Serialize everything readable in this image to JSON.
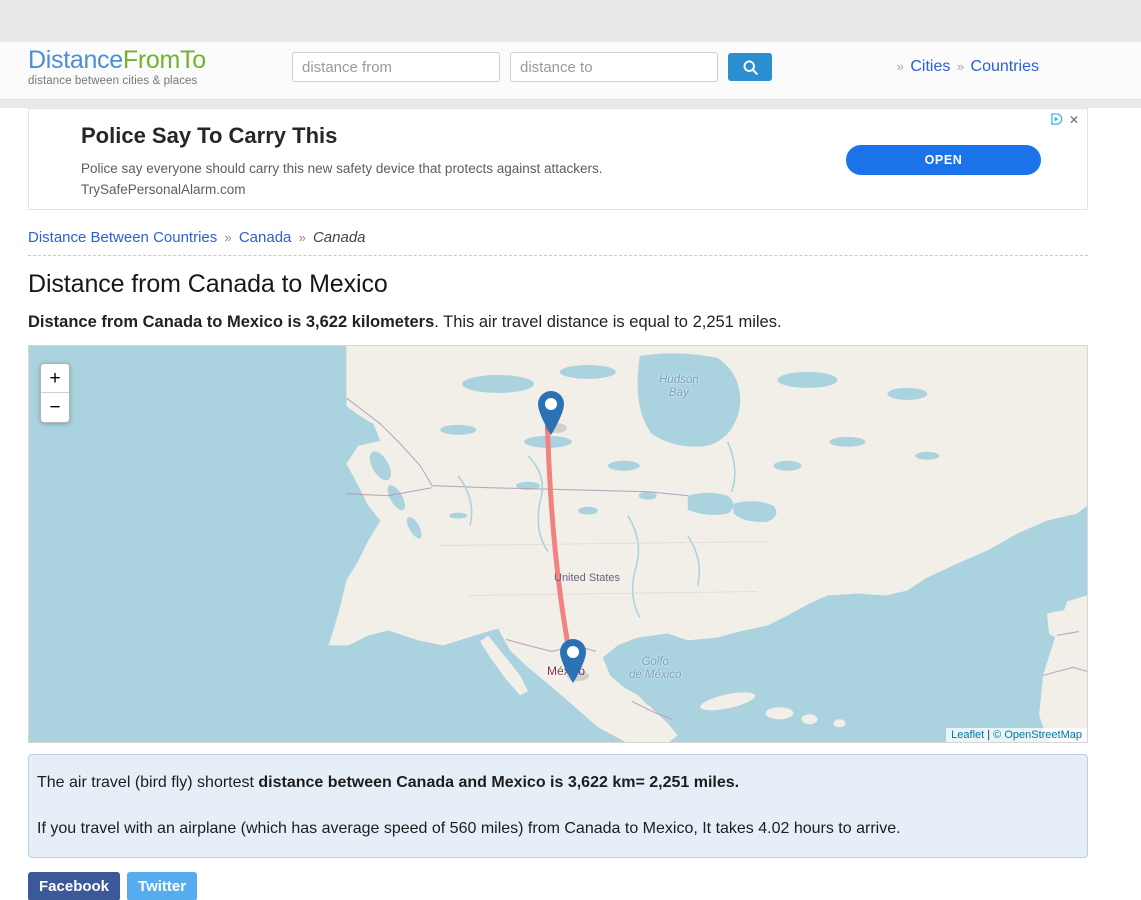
{
  "header": {
    "logo_main_a": "Distance",
    "logo_main_b": "FromTo",
    "logo_tagline": "distance between cities & places",
    "input_from_placeholder": "distance from",
    "input_from_value": "",
    "input_to_placeholder": "distance to",
    "input_to_value": "",
    "search_icon": "search-icon",
    "nav": {
      "sep": "»",
      "cities": "Cities",
      "countries": "Countries"
    }
  },
  "ad": {
    "headline": "Police Say To Carry This",
    "description": "Police say everyone should carry this new safety device that protects against attackers.",
    "url": "TrySafePersonalAlarm.com",
    "cta": "OPEN",
    "adchoices_icon": "adchoices-icon",
    "close_icon": "close-icon",
    "cta_color": "#1a73e8"
  },
  "breadcrumb": {
    "root": "Distance Between Countries",
    "sep": "»",
    "level2": "Canada",
    "current": "Canada"
  },
  "main": {
    "title": "Distance from Canada to Mexico",
    "summary_bold": "Distance from Canada to Mexico is 3,622 kilometers",
    "summary_rest": ". This air travel distance is equal to 2,251 miles."
  },
  "map": {
    "zoom_in": "+",
    "zoom_out": "−",
    "attribution_leaflet": "Leaflet",
    "attribution_divider": "|",
    "attribution_osm": "© OpenStreetMap",
    "labels": {
      "hudson_bay_line1": "Hudson",
      "hudson_bay_line2": "Bay",
      "united_states": "United States",
      "golfo_line1": "Golfo",
      "golfo_line2": "de México",
      "mexico_city": "México"
    },
    "marker_color": "#2a72b5",
    "line_color": "#f28282",
    "water_color": "#aad3df",
    "land_color": "#f2efe9"
  },
  "result": {
    "line1_pre": "The air travel (bird fly) shortest ",
    "line1_bold": "distance between Canada and Mexico is 3,622 km= 2,251 miles.",
    "line2": "If you travel with an airplane (which has average speed of 560 miles) from Canada to Mexico, It takes 4.02 hours to arrive."
  },
  "social": {
    "facebook": "Facebook",
    "twitter": "Twitter",
    "facebook_color": "#3b5998",
    "twitter_color": "#55acee"
  }
}
